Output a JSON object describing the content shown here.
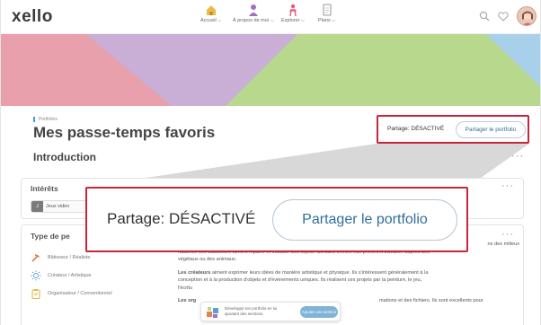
{
  "app": {
    "logo": "xello"
  },
  "nav": {
    "items": [
      {
        "label": "Accueil",
        "icon": "home-icon"
      },
      {
        "label": "À propos de moi",
        "icon": "person-icon"
      },
      {
        "label": "Explorer",
        "icon": "explore-person-icon"
      },
      {
        "label": "Plans",
        "icon": "plans-document-icon"
      }
    ],
    "right_icons": [
      "search-icon",
      "heart-icon",
      "avatar"
    ]
  },
  "banner": {
    "colors": [
      "#e9a0ad",
      "#c9aed6",
      "#b8d88e",
      "#a8d0ea"
    ]
  },
  "breadcrumb": "Portfolios",
  "page_title": "Mes passe-temps favoris",
  "section_intro": "Introduction",
  "share": {
    "status_label": "Partage: DÉSACTIVÉ",
    "button_label": "Partager le portfolio"
  },
  "interests_card": {
    "title": "Intérêts",
    "chip_letter": "J",
    "chip_text": "Jeux vidéo"
  },
  "type_card": {
    "title_partial": "Type de pe",
    "items": [
      {
        "label": "Bâtisseur / Réaliste",
        "icon": "hammer-icon",
        "color": "#e8824a"
      },
      {
        "label": "Créateur / Artistique",
        "icon": "sun-icon",
        "color": "#5aa0d8"
      },
      {
        "label": "Organisateur / Conventionnel",
        "icon": "clipboard-icon",
        "color": "#e6b84a"
      }
    ],
    "paragraph1_end": "ns des milieux",
    "paragraph1_lines": [
      "naturels. Les bâtisseurs aiment réparer et installer des objets. Certains d'entre eux préfèrent travailler auprès des",
      "végétaux ou des animaux."
    ],
    "paragraph2_bold": "Les créateurs",
    "paragraph2_lines": [
      " aiment exprimer leurs idées de manière artistique et physique. Ils s'intéressent généralement à la",
      "conception et à la production d'objets et d'événements uniques. Ils réalisent ces projets par la peinture, le jeu,",
      "l'écritu"
    ],
    "paragraph3_bold": "Les org",
    "paragraph3_end": "mations et des fichiers. Ils sont excellents pour"
  },
  "toast": {
    "text": "Développe ton portfolio en lui ajoutant des sections.",
    "button_label": "Ajouter une section"
  },
  "more_label": "···"
}
